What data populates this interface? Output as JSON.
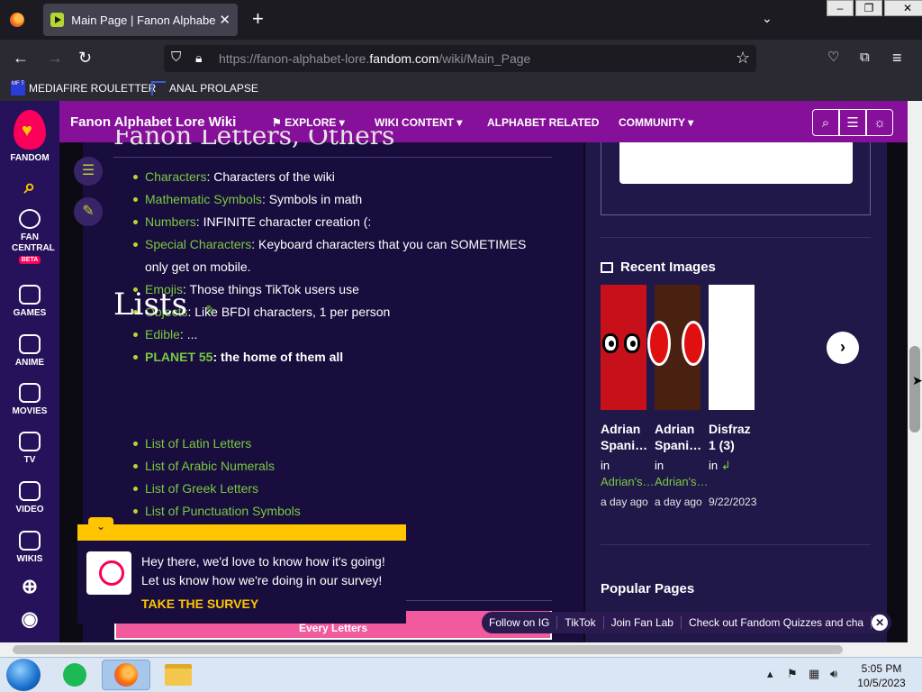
{
  "browser": {
    "tab_title": "Main Page | Fanon Alphabet Lore Wiki | Fandom",
    "tab_close": "✕",
    "new_tab": "+",
    "url_prefix": "https://fanon-alphabet-lore.",
    "url_domain": "fandom.com",
    "url_path": "/wiki/Main_Page",
    "window_buttons": [
      "‒",
      "❐",
      "✕"
    ],
    "bookmarks": [
      {
        "label": "MEDIAFIRE ROULETTER",
        "icon": "mft-icon"
      },
      {
        "label": "ANAL PROLAPSE",
        "icon": "bookmark-icon"
      }
    ]
  },
  "fandom_rail": {
    "logo_label": "FANDOM",
    "items": [
      {
        "label": "FAN CENTRAL",
        "badge": "BETA",
        "icon": "rocket-icon"
      },
      {
        "label": "GAMES",
        "icon": "gamepad-icon"
      },
      {
        "label": "ANIME",
        "icon": "anime-icon"
      },
      {
        "label": "MOVIES",
        "icon": "clapper-icon"
      },
      {
        "label": "TV",
        "icon": "tv-icon"
      },
      {
        "label": "VIDEO",
        "icon": "play-icon"
      },
      {
        "label": "WIKIS",
        "icon": "book-icon"
      }
    ]
  },
  "wiki_header": {
    "title": "Fanon Alphabet Lore Wiki",
    "nav": [
      {
        "label": "EXPLORE",
        "dropdown": true
      },
      {
        "label": "WIKI CONTENT",
        "dropdown": true
      },
      {
        "label": "ALPHABET RELATED",
        "dropdown": false
      },
      {
        "label": "COMMUNITY",
        "dropdown": true
      }
    ]
  },
  "main": {
    "section_heading": "Fanon Letters, Others",
    "others_list": [
      {
        "link": "Characters",
        "text": ": Characters of the wiki"
      },
      {
        "link": "Mathematic Symbols",
        "text": ": Symbols in math"
      },
      {
        "link": "Numbers",
        "text": ": INFINITE character creation (:"
      },
      {
        "link": "Special Characters",
        "text": ": Keyboard characters that you can SOMETIMES only get on mobile."
      },
      {
        "link": "Emojis",
        "text": ": Those things TikTok users use"
      },
      {
        "link": "Objects",
        "text": ": Like BFDI characters, 1 per person"
      },
      {
        "link": "Edible",
        "text": ": ..."
      },
      {
        "link": "PLANET 55",
        "text": ": the home of them all",
        "bold": true
      }
    ],
    "lists_heading": "Lists",
    "lists": [
      "List of Latin Letters",
      "List of Arabic Numerals",
      "List of Greek Letters",
      "List of Punctuation Symbols"
    ],
    "pink_box_label": "Every Letters"
  },
  "survey": {
    "text": "Hey there, we'd love to know how it's going! Let us know how we're doing in our survey!",
    "link": "TAKE THE SURVEY"
  },
  "sidebar": {
    "recent_images_heading": "Recent Images",
    "images": [
      {
        "title": "Adrian Spani…",
        "in_label": "in",
        "in_link": "Adrian's…",
        "time": "a day ago"
      },
      {
        "title": "Adrian Spani…",
        "in_label": "in",
        "in_link": "Adrian's…",
        "time": "a day ago"
      },
      {
        "title": "Disfraz 1 (3)",
        "in_label": "in",
        "in_link": "↲",
        "time": "9/22/2023"
      }
    ],
    "popular_pages_heading": "Popular Pages"
  },
  "social_bar": [
    "Follow on IG",
    "TikTok",
    "Join Fan Lab",
    "Check out Fandom Quizzes and cha"
  ],
  "taskbar": {
    "time": "5:05 PM",
    "date": "10/5/2023"
  },
  "colors": {
    "wiki_header": "#87109b",
    "fandom_rail": "#26125a",
    "link": "#7ac943",
    "survey_accent": "#ffc500"
  }
}
